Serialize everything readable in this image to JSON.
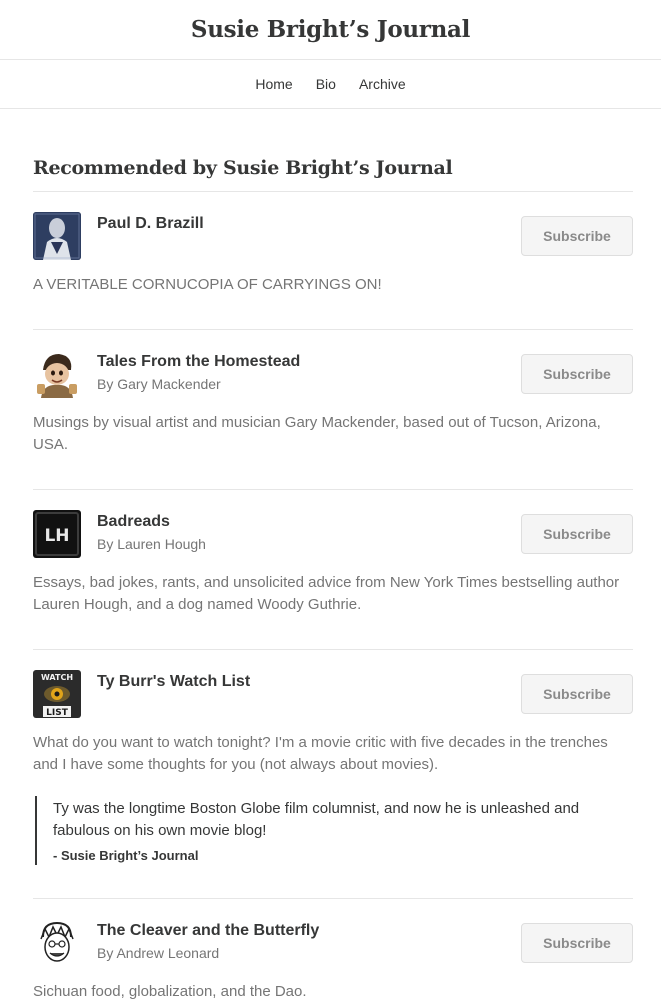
{
  "header": {
    "title": "Susie Bright’s Journal"
  },
  "nav": {
    "items": [
      "Home",
      "Bio",
      "Archive"
    ]
  },
  "section": {
    "title": "Recommended by Susie Bright’s Journal"
  },
  "subscribe_label": "Subscribe",
  "recommendations": [
    {
      "name": "Paul D. Brazill",
      "author": "",
      "description": "A VERITABLE CORNUCOPIA OF CARRYINGS ON!",
      "icon": "paul-brazill-avatar"
    },
    {
      "name": "Tales From the Homestead",
      "author": "By Gary Mackender",
      "description": "Musings by visual artist and musician Gary Mackender, based out of Tucson, Arizona, USA.",
      "icon": "homestead-avatar"
    },
    {
      "name": "Badreads",
      "author": "By Lauren Hough",
      "description": "Essays, bad jokes, rants, and unsolicited advice from New York Times bestselling author Lauren Hough, and a dog named Woody Guthrie.",
      "icon": "lh-logo",
      "logo_text": "LH"
    },
    {
      "name": "Ty Burr's Watch List",
      "author": "",
      "description": "What do you want to watch tonight? I'm a movie critic with five decades in the trenches and I have some thoughts for you (not always about movies).",
      "icon": "watch-list-logo",
      "logo_top": "WATCH",
      "logo_bottom": "LIST",
      "quote": "Ty was the longtime Boston Globe film columnist, and now he is unleashed and fabulous on his own movie blog!",
      "quote_attribution": "- Susie Bright’s Journal"
    },
    {
      "name": "The Cleaver and the Butterfly",
      "author": "By Andrew Leonard",
      "description": "Sichuan food, globalization, and the Dao.",
      "icon": "cleaver-avatar"
    }
  ],
  "colors": {
    "text": "#363737",
    "muted": "#757575",
    "divider": "#e6e6e6",
    "button_bg": "#f5f5f5"
  }
}
